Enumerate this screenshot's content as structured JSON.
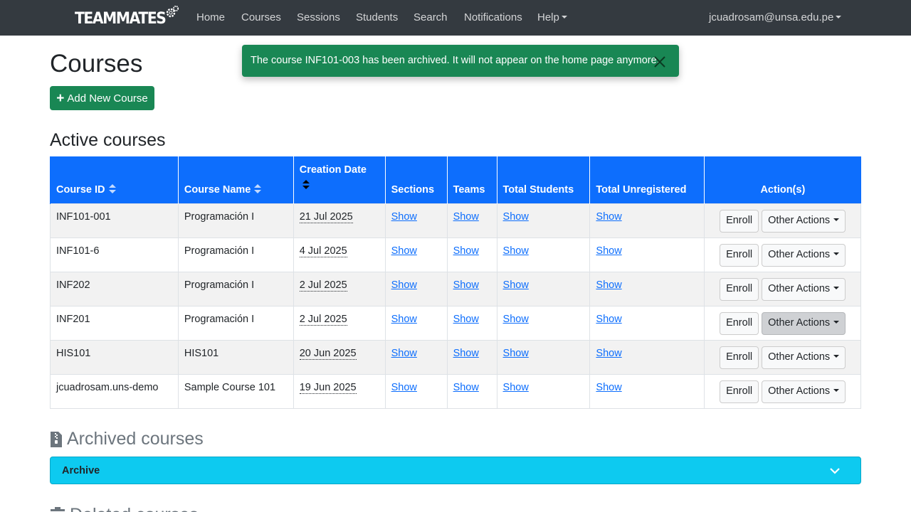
{
  "navbar": {
    "logo": "TEAMMATES",
    "links": [
      "Home",
      "Courses",
      "Sessions",
      "Students",
      "Search",
      "Notifications"
    ],
    "help": "Help",
    "user": "jcuadrosam@unsa.edu.pe"
  },
  "page": {
    "title": "Courses",
    "add_button": "Add New Course"
  },
  "toast": {
    "message": "The course INF101-003 has been archived. It will not appear on the home page anymore."
  },
  "active": {
    "title": "Active courses",
    "headers": {
      "course_id": "Course ID",
      "course_name": "Course Name",
      "creation_date": "Creation Date",
      "sections": "Sections",
      "teams": "Teams",
      "total_students": "Total Students",
      "total_unregistered": "Total Unregistered",
      "actions": "Action(s)"
    },
    "show_label": "Show",
    "enroll_label": "Enroll",
    "other_actions_label": "Other Actions",
    "rows": [
      {
        "id": "INF101-001",
        "name": "Programación I",
        "date": "21 Jul 2025"
      },
      {
        "id": "INF101-6",
        "name": "Programación I",
        "date": "4 Jul 2025"
      },
      {
        "id": "INF202",
        "name": "Programación I",
        "date": "2 Jul 2025"
      },
      {
        "id": "INF201",
        "name": "Programación I",
        "date": "2 Jul 2025"
      },
      {
        "id": "HIS101",
        "name": "HIS101",
        "date": "20 Jun 2025"
      },
      {
        "id": "jcuadrosam.uns-demo",
        "name": "Sample Course 101",
        "date": "19 Jun 2025"
      }
    ]
  },
  "archived": {
    "title": "Archived courses",
    "panel_label": "Archive"
  },
  "deleted": {
    "title": "Deleted courses"
  },
  "colors": {
    "navbar": "#343a40",
    "primary": "#0d6efd",
    "success": "#198754",
    "info": "#0dcaf0"
  }
}
